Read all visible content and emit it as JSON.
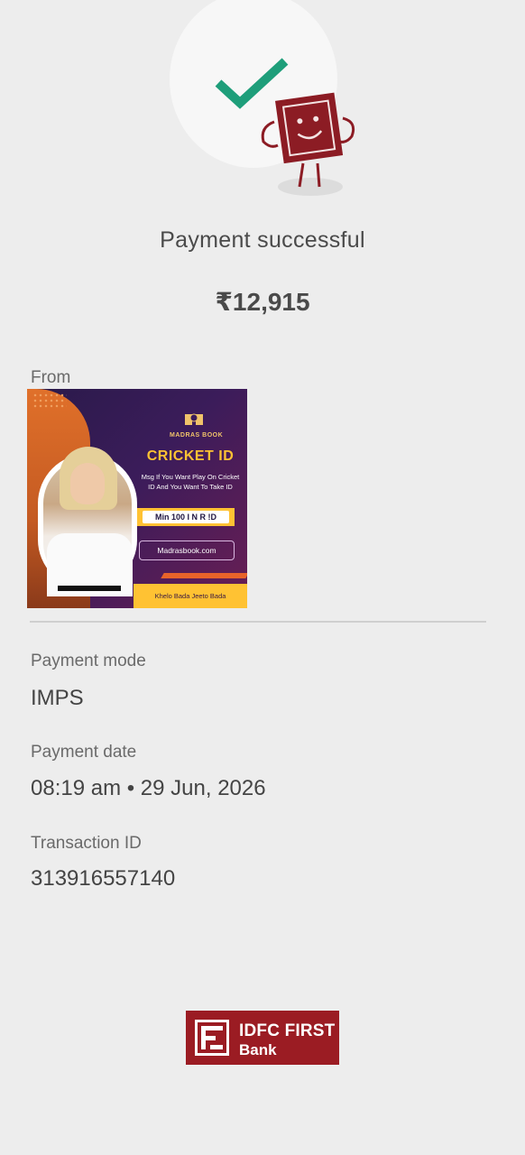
{
  "status": {
    "title": "Payment successful",
    "amount": "₹12,915"
  },
  "from": {
    "label": "From",
    "ad": {
      "brand": "MADRAS BOOK",
      "headline": "CRICKET ID",
      "message": "Msg If You Want Play On Cricket ID And You Want To Take ID",
      "min_amount": "Min 100 I N R !D",
      "website": "Madrasbook.com",
      "tagline": "Khelo Bada Jeeto Bada"
    }
  },
  "details": [
    {
      "label": "Payment mode",
      "value": "IMPS"
    },
    {
      "label": "Payment date",
      "value": "08:19 am • 29 Jun, 2026"
    },
    {
      "label": "Transaction ID",
      "value": "313916557140"
    }
  ],
  "bank": {
    "name_line1": "IDFC FIRST",
    "name_line2": "Bank",
    "color": "#9b1c23"
  },
  "colors": {
    "check": "#1e9e7a",
    "mascot": "#8c1c24",
    "background": "#ededed"
  },
  "icons": [
    "check-icon",
    "mascot-illustration",
    "idfc-logo-icon"
  ]
}
